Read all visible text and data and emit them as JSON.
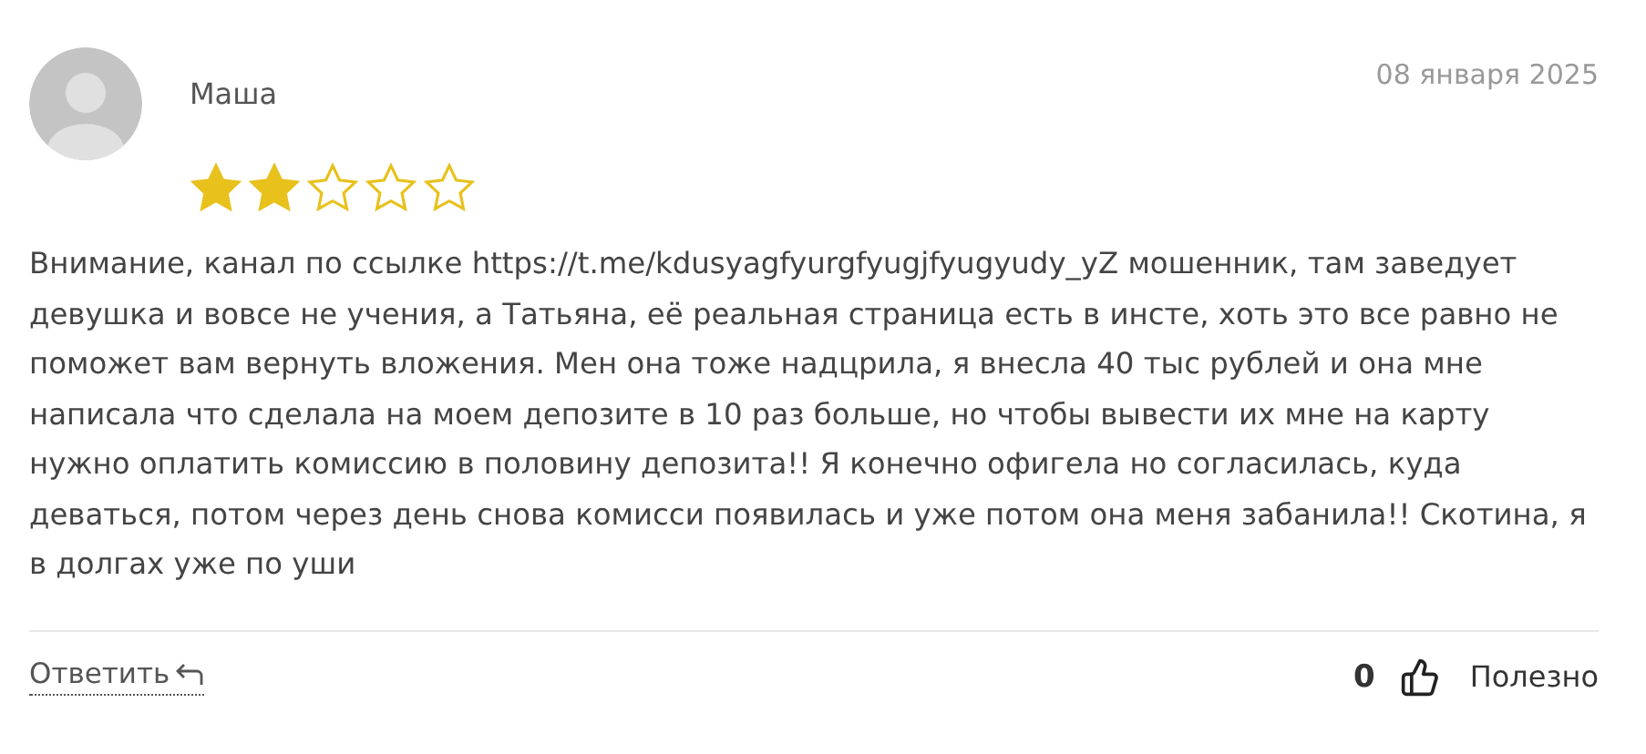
{
  "review": {
    "author": "Маша",
    "date": "08 января 2025",
    "stars": 2,
    "text": "Внимание, канал по ссылке https://t.me/kdusyagfyurgfyugjfyugyudy_yZ мошенник, там заведует девушка и вовсе не учения, а Татьяна, её реальная страница есть в инсте, хоть это все равно не поможет вам вернуть вложения. Мен она тоже надцрила, я внесла 40 тыс рублей и она мне написала что сделала на моем депозите в 10 раз больше, но чтобы вывести их мне на карту нужно оплатить комиссию в половину депозита!! Я конечно офигела но согласилась, куда деваться, потом через день снова комисси появилась и уже потом она меня забанила!! Скотина, я в долгах уже по уши",
    "reply_link": "Ответить",
    "likes": "0",
    "helpful": "Полезно"
  }
}
